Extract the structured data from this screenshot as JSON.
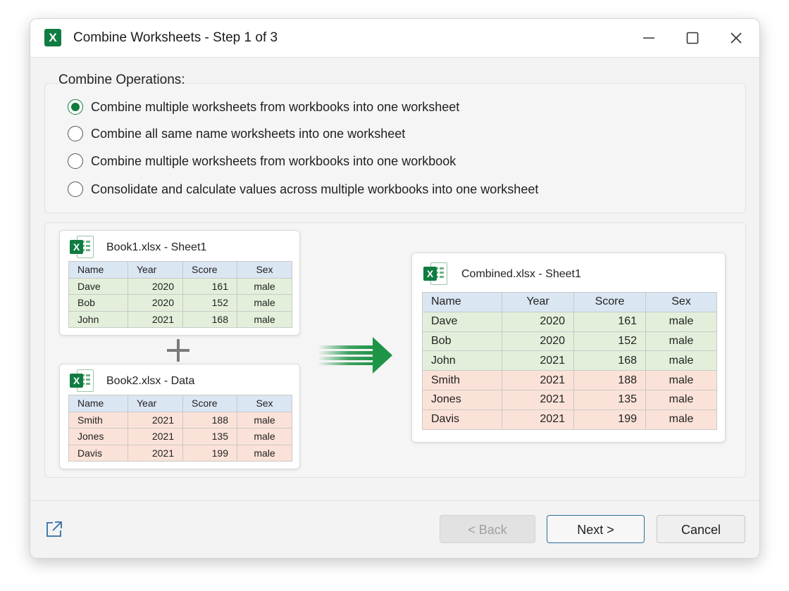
{
  "window": {
    "title": "Combine Worksheets  -  Step 1 of 3",
    "app_icon": "excel-icon",
    "app_icon_letter": "X",
    "controls": [
      "minimize-icon",
      "maximize-icon",
      "close-icon"
    ]
  },
  "operations": {
    "label": "Combine Operations:",
    "options": [
      {
        "label": "Combine multiple worksheets from workbooks into one worksheet",
        "checked": true
      },
      {
        "label": "Combine all same name worksheets into one worksheet",
        "checked": false
      },
      {
        "label": "Combine multiple worksheets from workbooks into one workbook",
        "checked": false
      },
      {
        "label": "Consolidate and calculate values across multiple workbooks into one worksheet",
        "checked": false
      }
    ]
  },
  "illustration": {
    "book1": {
      "title": "Book1.xlsx - Sheet1",
      "headers": [
        "Name",
        "Year",
        "Score",
        "Sex"
      ],
      "rows": [
        [
          "Dave",
          "2020",
          "161",
          "male"
        ],
        [
          "Bob",
          "2020",
          "152",
          "male"
        ],
        [
          "John",
          "2021",
          "168",
          "male"
        ]
      ]
    },
    "book2": {
      "title": "Book2.xlsx - Data",
      "headers": [
        "Name",
        "Year",
        "Score",
        "Sex"
      ],
      "rows": [
        [
          "Smith",
          "2021",
          "188",
          "male"
        ],
        [
          "Jones",
          "2021",
          "135",
          "male"
        ],
        [
          "Davis",
          "2021",
          "199",
          "male"
        ]
      ]
    },
    "combined": {
      "title": "Combined.xlsx - Sheet1",
      "headers": [
        "Name",
        "Year",
        "Score",
        "Sex"
      ],
      "rows": [
        [
          "Dave",
          "2020",
          "161",
          "male"
        ],
        [
          "Bob",
          "2020",
          "152",
          "male"
        ],
        [
          "John",
          "2021",
          "168",
          "male"
        ],
        [
          "Smith",
          "2021",
          "188",
          "male"
        ],
        [
          "Jones",
          "2021",
          "135",
          "male"
        ],
        [
          "Davis",
          "2021",
          "199",
          "male"
        ]
      ]
    },
    "colors": {
      "book1_rows": "#e3efda",
      "book2_rows": "#fbe2d8",
      "header": "#dbe6f3",
      "arrow": "#1e9447"
    },
    "icons": [
      "excel-file-icon",
      "plus-icon",
      "arrow-right-icon"
    ]
  },
  "footer": {
    "link_icon": "external-link-icon",
    "back_label": "< Back",
    "next_label": "Next >",
    "cancel_label": "Cancel"
  },
  "colors": {
    "accent": "#117a3d",
    "excel_green": "#107c41",
    "next_border": "#2d6e9b"
  }
}
